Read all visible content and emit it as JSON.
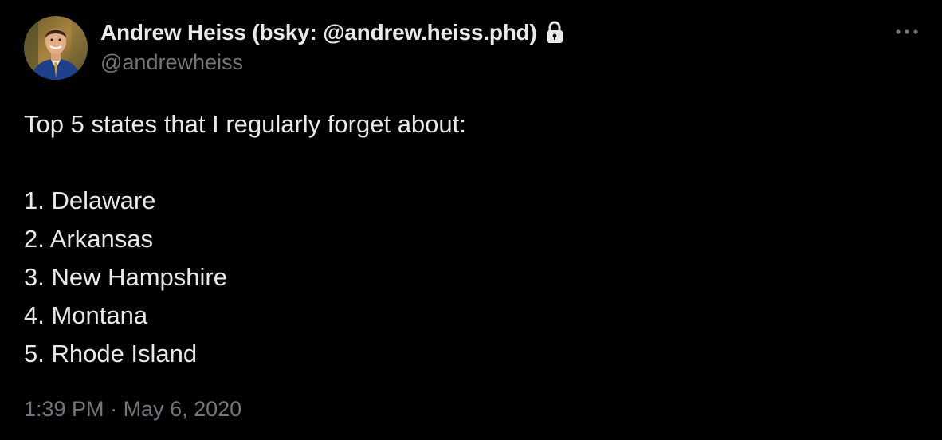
{
  "author": {
    "display_name": "Andrew Heiss (bsky: @andrew.heiss.phd)",
    "handle": "@andrewheiss",
    "avatar_icon": "profile-photo",
    "protected_icon": "lock-icon"
  },
  "menu": {
    "more_icon": "more-horizontal-icon"
  },
  "tweet": {
    "intro": "Top 5 states that I regularly forget about:",
    "items": [
      "1. Delaware",
      "2. Arkansas",
      "3. New Hampshire",
      "4. Montana",
      "5. Rhode Island"
    ]
  },
  "meta": {
    "time": "1:39 PM",
    "separator": " · ",
    "date": "May 6, 2020"
  },
  "colors": {
    "background": "#000000",
    "text": "#e7e9ea",
    "secondary": "#71767b"
  }
}
